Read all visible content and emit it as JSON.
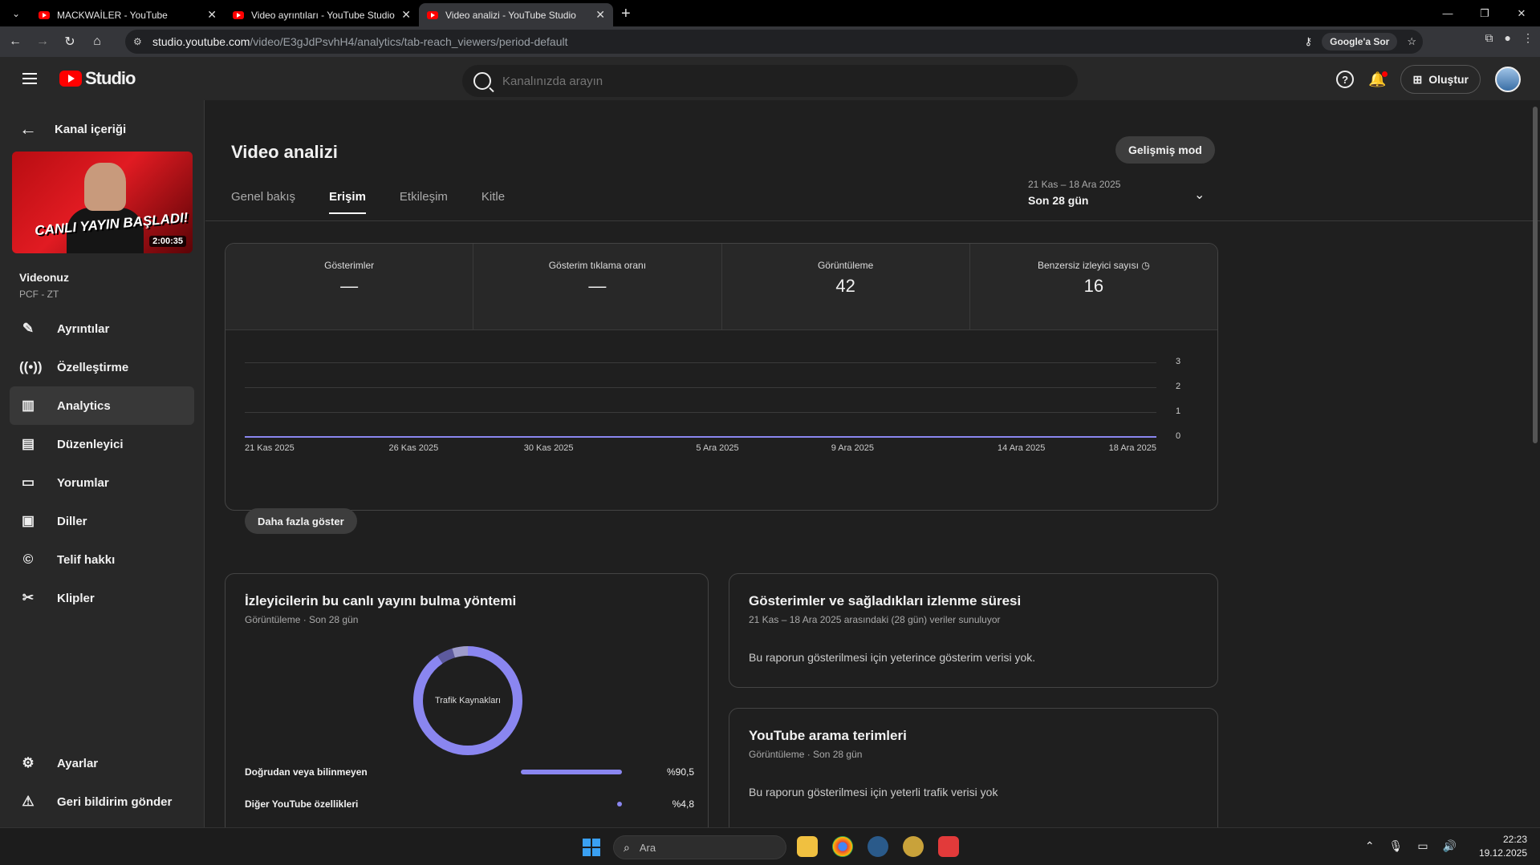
{
  "browser": {
    "tabs": [
      {
        "title": "MACKWAİLER - YouTube",
        "active": false
      },
      {
        "title": "Video ayrıntıları - YouTube Studio",
        "active": false
      },
      {
        "title": "Video analizi - YouTube Studio",
        "active": true
      }
    ],
    "new_tab_icon": "plus-icon",
    "url_host": "studio.youtube.com",
    "url_path": "/video/E3gJdPsvhH4/analytics/tab-reach_viewers/period-default",
    "google_ask": "Google'a Sor"
  },
  "header": {
    "logo_text": "Studio",
    "search_placeholder": "Kanalınızda arayın",
    "create_label": "Oluştur"
  },
  "sidebar": {
    "back_label": "Kanal içeriği",
    "thumb_text": "CANLI YAYIN BAŞLADI!",
    "thumb_duration": "2:00:35",
    "video_label": "Videonuz",
    "video_sub": "PCF - ZT",
    "items": [
      {
        "label": "Ayrıntılar",
        "icon": "pencil-icon"
      },
      {
        "label": "Özelleştirme",
        "icon": "broadcast-icon"
      },
      {
        "label": "Analytics",
        "icon": "analytics-icon",
        "active": true
      },
      {
        "label": "Düzenleyici",
        "icon": "editor-icon"
      },
      {
        "label": "Yorumlar",
        "icon": "comment-icon"
      },
      {
        "label": "Diller",
        "icon": "subtitles-icon"
      },
      {
        "label": "Telif hakkı",
        "icon": "copyright-icon"
      },
      {
        "label": "Klipler",
        "icon": "scissors-icon"
      }
    ],
    "bottom_items": [
      {
        "label": "Ayarlar",
        "icon": "gear-icon"
      },
      {
        "label": "Geri bildirim gönder",
        "icon": "feedback-icon"
      }
    ]
  },
  "main": {
    "title": "Video analizi",
    "advanced_mode": "Gelişmiş mod",
    "tabs": [
      "Genel bakış",
      "Erişim",
      "Etkileşim",
      "Kitle"
    ],
    "active_tab": "Erişim",
    "date_range": "21 Kas – 18 Ara 2025",
    "period": "Son 28 gün",
    "metrics": [
      {
        "label": "Gösterimler",
        "value": "—"
      },
      {
        "label": "Gösterim tıklama oranı",
        "value": "—"
      },
      {
        "label": "Görüntüleme",
        "value": "42"
      },
      {
        "label": "Benzersiz izleyici sayısı",
        "value": "16"
      }
    ],
    "show_more": "Daha fazla göster",
    "traffic_card": {
      "title": "İzleyicilerin bu canlı yayını bulma yöntemi",
      "subtitle": "Görüntüleme · Son 28 gün",
      "donut_label": "Trafik Kaynakları",
      "sources": [
        {
          "label": "Doğrudan veya bilinmeyen",
          "pct": "%90,5",
          "value": 90.5
        },
        {
          "label": "Diğer YouTube özellikleri",
          "pct": "%4,8",
          "value": 4.8
        }
      ]
    },
    "impressions_card": {
      "title": "Gösterimler ve sağladıkları izlenme süresi",
      "subtitle": "21 Kas – 18 Ara 2025 arasındaki (28 gün) veriler sunuluyor",
      "message": "Bu raporun gösterilmesi için yeterince gösterim verisi yok."
    },
    "search_card": {
      "title": "YouTube arama terimleri",
      "subtitle": "Görüntüleme · Son 28 gün",
      "message": "Bu raporun gösterilmesi için yeterli trafik verisi yok"
    }
  },
  "chart_data": {
    "type": "line",
    "x": [
      "21 Kas 2025",
      "26 Kas 2025",
      "30 Kas 2025",
      "5 Ara 2025",
      "9 Ara 2025",
      "14 Ara 2025",
      "18 Ara 2025"
    ],
    "series": [
      {
        "values": [
          0,
          0,
          0,
          0,
          0,
          0,
          0
        ]
      }
    ],
    "ylim": [
      0,
      3
    ],
    "yticks": [
      "3",
      "2",
      "1",
      "0"
    ],
    "grid": true,
    "title": "",
    "xlabel": "",
    "ylabel": ""
  },
  "taskbar": {
    "search_placeholder": "Ara",
    "time": "22:23",
    "date": "19.12.2025"
  },
  "colors": {
    "accent": "#8a86f0",
    "youtube_red": "#ff0000"
  }
}
